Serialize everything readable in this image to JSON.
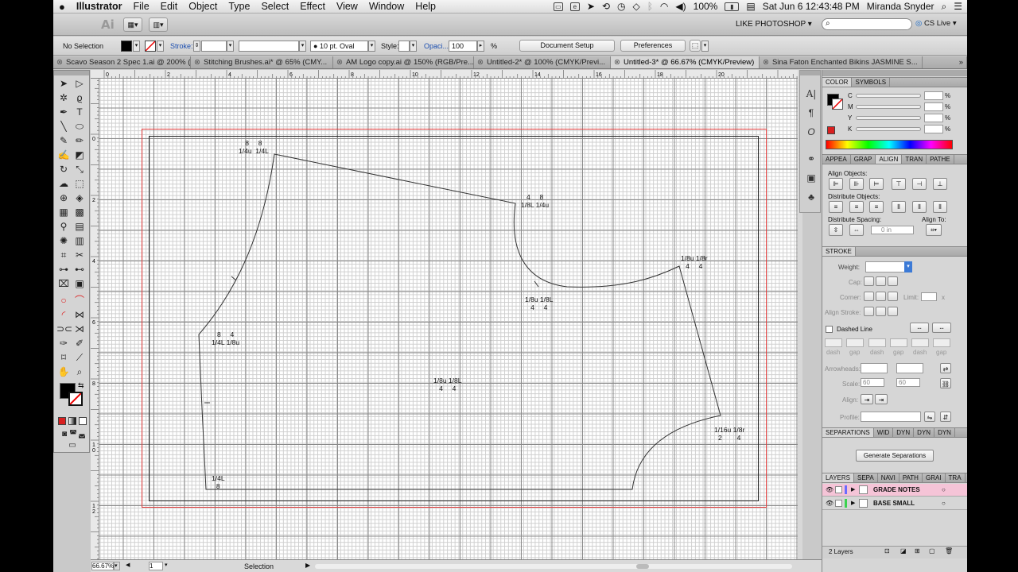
{
  "menubar": {
    "apple": "",
    "app": "Illustrator",
    "items": [
      "File",
      "Edit",
      "Object",
      "Type",
      "Select",
      "Effect",
      "View",
      "Window",
      "Help"
    ],
    "battery": "100%",
    "clock": "Sat Jun 6  12:43:48 PM",
    "user": "Miranda Snyder"
  },
  "appbar": {
    "logo": "Ai",
    "workspace": "LIKE PHOTOSHOP ▾",
    "cslive": "CS Live ▾",
    "search_placeholder": ""
  },
  "control": {
    "selection": "No Selection",
    "stroke_label": "Stroke:",
    "brush": "10 pt. Oval",
    "style_label": "Style:",
    "opacity_label": "Opaci...:",
    "opacity": "100",
    "percent": "%",
    "doc_setup": "Document Setup",
    "preferences": "Preferences"
  },
  "tabs": [
    {
      "label": "Scavo Season 2 Spec 1.ai @ 200% (..."
    },
    {
      "label": "Stitching Brushes.ai* @ 65% (CMY..."
    },
    {
      "label": "AM Logo copy.ai @ 150% (RGB/Pre..."
    },
    {
      "label": "Untitled-2* @ 100% (CMYK/Previ..."
    },
    {
      "label": "Untitled-3* @ 66.67% (CMYK/Preview)"
    },
    {
      "label": "Sina Faton Enchanted Bikins JASMINE S..."
    }
  ],
  "ruler_top": [
    "0",
    "2",
    "4",
    "6",
    "8",
    "10",
    "12",
    "14",
    "16",
    "18",
    "20"
  ],
  "ruler_left": [
    "0",
    "2",
    "4",
    "6",
    "8",
    "1\n0",
    "1\n2"
  ],
  "grade_labels": [
    {
      "l1": "8     8",
      "l2": "1/4u  1/4L"
    },
    {
      "l1": "4     8",
      "l2": "1/8L 1/4u"
    },
    {
      "l1": "1/8u 1/8r",
      "l2": "4     4"
    },
    {
      "l1": "1/8u 1/8L",
      "l2": "4     4"
    },
    {
      "l1": "8     4",
      "l2": "1/4L 1/8u"
    },
    {
      "l1": "1/8u 1/8L",
      "l2": "4     4"
    },
    {
      "l1": "1/16u 1/8r",
      "l2": "2        4"
    },
    {
      "l1": "1/4L",
      "l2": "8"
    }
  ],
  "status": {
    "zoom": "66.67%",
    "page": "1",
    "tool": "Selection"
  },
  "color_panel": {
    "tab1": "COLOR",
    "tab2": "SYMBOLS",
    "channels": [
      "C",
      "M",
      "Y",
      "K"
    ],
    "percent": "%"
  },
  "align_panel": {
    "tabs": [
      "APPEA",
      "GRAP",
      "ALIGN",
      "TRAN",
      "PATHE"
    ],
    "align_objects": "Align Objects:",
    "distribute_objects": "Distribute Objects:",
    "distribute_spacing": "Distribute Spacing:",
    "align_to": "Align To:",
    "spacing_value": "0 in"
  },
  "stroke_panel": {
    "title": "STROKE",
    "weight": "Weight:",
    "cap": "Cap:",
    "corner": "Corner:",
    "limit": "Limit:",
    "limit_x": "x",
    "align_stroke": "Align Stroke:",
    "dashed": "Dashed Line",
    "dash_labels": [
      "dash",
      "gap",
      "dash",
      "gap",
      "dash",
      "gap"
    ],
    "arrowheads": "Arrowheads:",
    "scale": "Scale:",
    "scale_a": "60",
    "scale_b": "60",
    "align": "Align:",
    "profile": "Profile:"
  },
  "separations": {
    "tabs": [
      "SEPARATIONS",
      "WID",
      "DYN",
      "DYN",
      "DYN"
    ],
    "button": "Generate Separations"
  },
  "layers": {
    "tabs": [
      "LAYERS",
      "SEPA",
      "NAVI",
      "PATH",
      "GRAI",
      "TRA"
    ],
    "items": [
      {
        "name": "GRADE NOTES",
        "color": "#6b6bff"
      },
      {
        "name": "BASE SMALL",
        "color": "#3bd34f"
      }
    ],
    "count": "2 Layers"
  },
  "colors": {
    "grade_notes_highlight": "#f5c4d7",
    "artboard_red": "#e23b3b",
    "fill_red": "#d92020"
  }
}
